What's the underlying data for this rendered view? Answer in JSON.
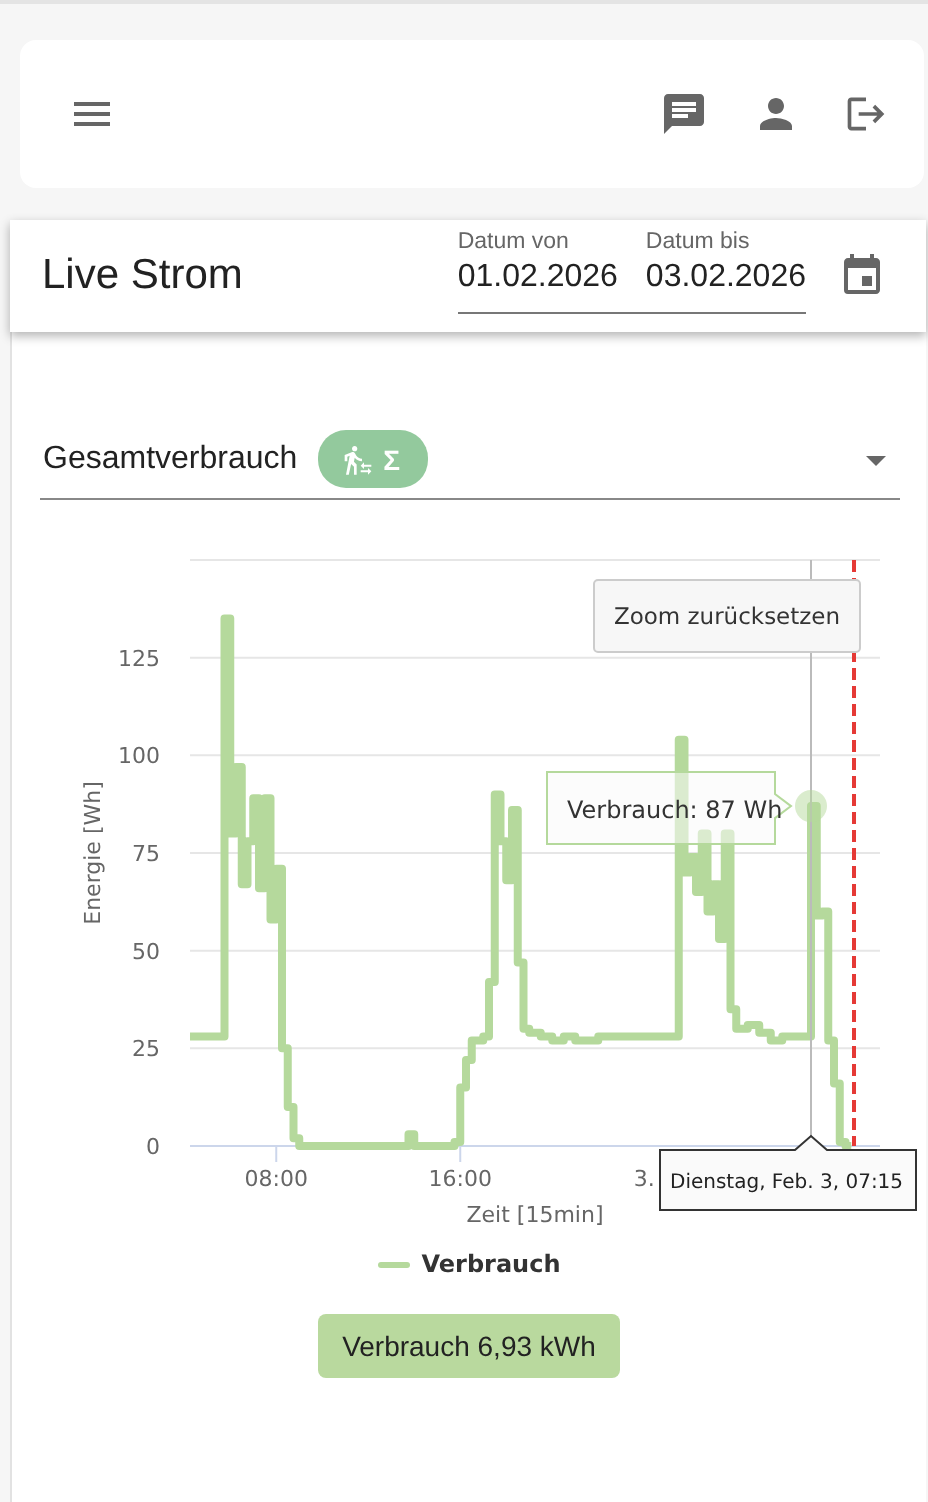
{
  "page": {
    "title": "Live Strom",
    "date_from": {
      "label": "Datum von",
      "value": "01.02.2026"
    },
    "date_to": {
      "label": "Datum bis",
      "value": "03.02.2026"
    }
  },
  "selector": {
    "value": "Gesamtverbrauch",
    "chip_symbol": "Σ"
  },
  "chart": {
    "zoom_button": "Zoom zurücksetzen",
    "cut_tick_label": "3.",
    "tooltip": {
      "text": "Verbrauch: 87 Wh",
      "x_label": "Dienstag, Feb. 3, 07:15"
    },
    "chart_data": {
      "type": "line",
      "xlabel": "Zeit [15min]",
      "ylabel": "Energie [Wh]",
      "grid": true,
      "x": [
        4.25,
        5.75,
        5.75,
        6,
        6,
        6.25,
        6.25,
        6.5,
        6.5,
        6.75,
        6.75,
        7,
        7,
        7.25,
        7.25,
        7.5,
        7.5,
        7.75,
        7.75,
        8,
        8,
        8.25,
        8.25,
        8.5,
        8.5,
        8.75,
        8.75,
        9,
        9,
        13.75,
        13.75,
        14,
        14,
        15.75,
        15.75,
        16,
        16,
        16.25,
        16.25,
        16.5,
        16.5,
        17,
        17,
        17.25,
        17.25,
        17.5,
        17.5,
        17.75,
        17.75,
        18,
        18,
        18.25,
        18.25,
        18.5,
        18.5,
        18.75,
        18.75,
        19,
        19,
        19.5,
        19.5,
        20,
        20,
        20.5,
        20.5,
        21,
        21,
        22,
        22,
        25.5,
        25.5,
        25.75,
        25.75,
        26,
        26,
        26.25,
        26.25,
        26.5,
        26.5,
        26.75,
        26.75,
        27,
        27,
        27.25,
        27.25,
        27.5,
        27.5,
        27.75,
        27.75,
        28,
        28,
        28.5,
        28.5,
        29,
        29,
        29.5,
        29.5,
        30,
        30,
        31.25,
        31.25,
        31.5,
        31.5,
        31.75,
        31.75,
        32,
        32,
        32.25,
        32.25,
        32.5,
        32.5,
        32.75,
        32.75,
        33
      ],
      "series": [
        {
          "name": "Verbrauch",
          "color": "#b5d99c",
          "values": [
            28,
            28,
            135,
            135,
            80,
            80,
            97,
            97,
            67,
            67,
            78,
            78,
            89,
            89,
            66,
            66,
            89,
            89,
            58,
            58,
            71,
            71,
            25,
            25,
            10,
            10,
            2,
            2,
            0,
            0,
            3,
            3,
            0,
            0,
            1,
            1,
            15,
            15,
            22,
            22,
            27,
            27,
            28,
            28,
            42,
            42,
            90,
            90,
            78,
            78,
            68,
            68,
            86,
            86,
            47,
            47,
            30,
            30,
            29,
            29,
            28,
            28,
            27,
            27,
            28,
            28,
            27,
            27,
            28,
            28,
            104,
            104,
            70,
            70,
            74,
            74,
            65,
            65,
            80,
            80,
            60,
            60,
            67,
            67,
            53,
            53,
            80,
            80,
            35,
            35,
            30,
            30,
            31,
            31,
            29,
            29,
            27,
            27,
            28,
            28,
            87,
            87,
            59,
            59,
            60,
            60,
            27,
            27,
            16,
            16,
            1,
            1,
            0,
            0
          ]
        }
      ],
      "xlim": [
        4.25,
        34.25
      ],
      "ylim": [
        0,
        150
      ],
      "xticks": [
        {
          "value": 8,
          "label": "08:00"
        },
        {
          "value": 16,
          "label": "16:00"
        }
      ],
      "yticks": [
        0,
        25,
        50,
        75,
        100,
        125
      ],
      "ref_lines": [
        {
          "axis": "x",
          "value": 31.25,
          "color": "#bbbbbb"
        },
        {
          "axis": "x",
          "value": 33.12,
          "color": "#e53935"
        }
      ]
    }
  },
  "total_button": "Verbrauch 6,93 kWh"
}
